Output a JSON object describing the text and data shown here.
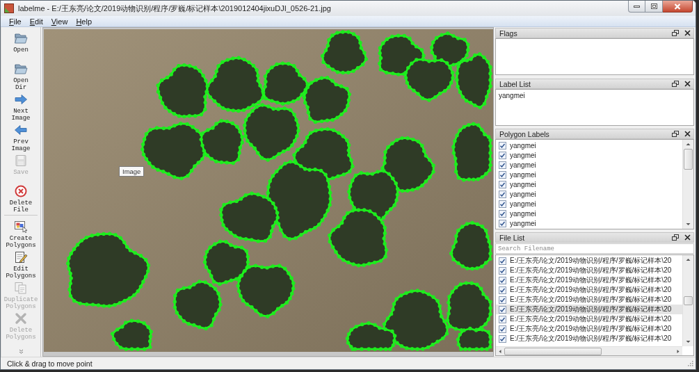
{
  "window": {
    "title": "labelme - E:/王东亮/论文/2019动物识别/程序/罗巍/标记样本\\2019012404jixuDJI_0526-21.jpg"
  },
  "menu": [
    "File",
    "Edit",
    "View",
    "Help"
  ],
  "toolbar_groups": [
    {
      "items": [
        {
          "label": "Open",
          "kind": "folder",
          "disabled": false
        },
        {
          "label": "Open Dir",
          "kind": "folder",
          "disabled": false
        },
        {
          "label": "Next Image",
          "kind": "next",
          "disabled": false
        },
        {
          "label": "Prev Image",
          "kind": "prev",
          "disabled": false
        },
        {
          "label": "Save",
          "kind": "save",
          "disabled": true
        },
        {
          "label": "Delete File",
          "kind": "delete",
          "disabled": false
        }
      ]
    },
    {
      "items": [
        {
          "label": "Create Polygons",
          "kind": "create",
          "disabled": false
        },
        {
          "label": "Edit Polygons",
          "kind": "edit",
          "disabled": false
        },
        {
          "label": "Duplicate Polygons",
          "kind": "duplicate",
          "disabled": true
        },
        {
          "label": "Delete Polygons",
          "kind": "remove",
          "disabled": true
        }
      ]
    }
  ],
  "canvas": {
    "tooltip": "Image"
  },
  "flags": {
    "title": "Flags"
  },
  "label_list": {
    "title": "Label List",
    "items": [
      {
        "text": "yangmei",
        "selected": false
      }
    ]
  },
  "polygon_labels": {
    "title": "Polygon Labels",
    "items": [
      {
        "text": "yangmei",
        "checked": true,
        "selected": false
      },
      {
        "text": "yangmei",
        "checked": true,
        "selected": false
      },
      {
        "text": "yangmei",
        "checked": true,
        "selected": false
      },
      {
        "text": "yangmei",
        "checked": true,
        "selected": false
      },
      {
        "text": "yangmei",
        "checked": true,
        "selected": false
      },
      {
        "text": "yangmei",
        "checked": true,
        "selected": false
      },
      {
        "text": "yangmei",
        "checked": true,
        "selected": false
      },
      {
        "text": "yangmei",
        "checked": true,
        "selected": false
      },
      {
        "text": "yangmei",
        "checked": true,
        "selected": false
      }
    ]
  },
  "file_list": {
    "title": "File List",
    "search": {
      "placeholder": "Search Filename"
    },
    "items": [
      {
        "path": "E:/王东亮/论文/2019动物识别/程序/罗巍/标记样本\\20",
        "checked": true,
        "selected": false
      },
      {
        "path": "E:/王东亮/论文/2019动物识别/程序/罗巍/标记样本\\20",
        "checked": true,
        "selected": false
      },
      {
        "path": "E:/王东亮/论文/2019动物识别/程序/罗巍/标记样本\\20",
        "checked": true,
        "selected": false
      },
      {
        "path": "E:/王东亮/论文/2019动物识别/程序/罗巍/标记样本\\20",
        "checked": true,
        "selected": false
      },
      {
        "path": "E:/王东亮/论文/2019动物识别/程序/罗巍/标记样本\\20",
        "checked": true,
        "selected": false
      },
      {
        "path": "E:/王东亮/论文/2019动物识别/程序/罗巍/标记样本\\20",
        "checked": true,
        "selected": true
      },
      {
        "path": "E:/王东亮/论文/2019动物识别/程序/罗巍/标记样本\\20",
        "checked": true,
        "selected": false
      },
      {
        "path": "E:/王东亮/论文/2019动物识别/程序/罗巍/标记样本\\20",
        "checked": true,
        "selected": false
      },
      {
        "path": "E:/王东亮/论文/2019动物识别/程序/罗巍/标记样本\\20",
        "checked": true,
        "selected": false
      }
    ]
  },
  "status_bar": {
    "text": "Click & drag to move point"
  }
}
